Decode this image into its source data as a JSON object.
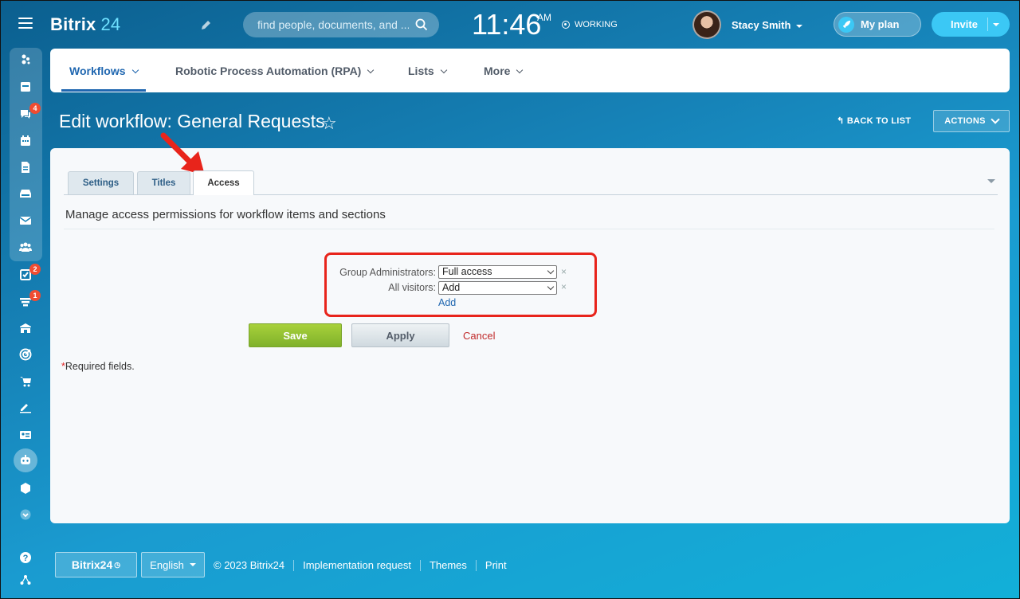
{
  "app": {
    "logo_name": "Bitrix",
    "logo_num": "24",
    "search_placeholder": "find people, documents, and ...",
    "clock_time": "11:46",
    "clock_ampm": "AM",
    "work_status": "WORKING",
    "user_name": "Stacy Smith",
    "my_plan": "My plan",
    "invite": "Invite"
  },
  "sidebar": {
    "badges": {
      "chat": "4",
      "tasks": "2",
      "crm": "1"
    }
  },
  "nav": {
    "items": [
      {
        "label": "Workflows"
      },
      {
        "label": "Robotic Process Automation (RPA)"
      },
      {
        "label": "Lists"
      },
      {
        "label": "More"
      }
    ]
  },
  "page": {
    "title": "Edit workflow: General Requests",
    "back_to_list": "BACK TO LIST",
    "actions": "ACTIONS"
  },
  "tabs": [
    {
      "label": "Settings"
    },
    {
      "label": "Titles"
    },
    {
      "label": "Access"
    }
  ],
  "access": {
    "description": "Manage access permissions for workflow items and sections",
    "rows": [
      {
        "label": "Group Administrators:",
        "value": "Full access"
      },
      {
        "label": "All visitors:",
        "value": "Add"
      }
    ],
    "add_link": "Add"
  },
  "buttons": {
    "save": "Save",
    "apply": "Apply",
    "cancel": "Cancel"
  },
  "required_note": "Required fields.",
  "required_mark": "*",
  "footer": {
    "logo": "Bitrix24",
    "language": "English",
    "copyright": "© 2023 Bitrix24",
    "links": [
      "Implementation request",
      "Themes",
      "Print"
    ]
  },
  "colors": {
    "accent_blue": "#2067b0",
    "invite": "#3bc8f5",
    "save_green": "#8bbf2f",
    "highlight_red": "#e8241b",
    "badge_red": "#f04c31"
  }
}
